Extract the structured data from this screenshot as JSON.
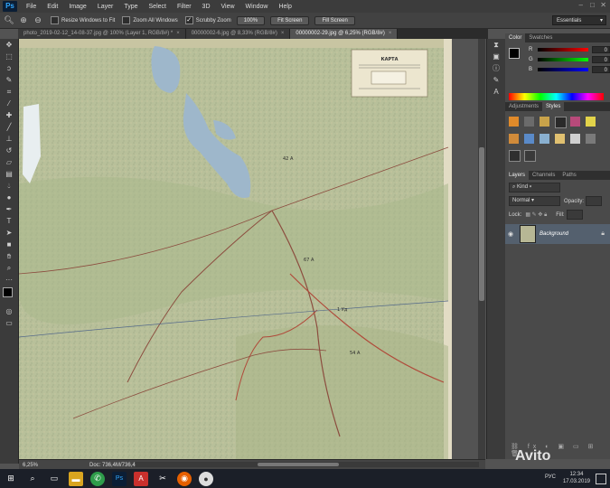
{
  "menubar": {
    "logo": "Ps",
    "items": [
      "File",
      "Edit",
      "Image",
      "Layer",
      "Type",
      "Select",
      "Filter",
      "3D",
      "View",
      "Window",
      "Help"
    ]
  },
  "options": {
    "resize_windows": "Resize Windows to Fit",
    "zoom_all": "Zoom All Windows",
    "scrubby_zoom": "Scrubby Zoom",
    "zoom_btn": "100%",
    "fit_screen": "Fit Screen",
    "fill_screen": "Fill Screen",
    "workspace": "Essentials"
  },
  "tabs": [
    {
      "label": "photo_2019-02-12_14-08-37.jpg @ 100% (Layer 1, RGB/8#) *"
    },
    {
      "label": "00000002-6.jpg @ 8,33% (RGB/8#)"
    },
    {
      "label": "00000002-29.jpg @ 6,25% (RGB/8#)"
    }
  ],
  "map": {
    "stamp_lines": [
      "КАРТА",
      "...",
      "..."
    ],
    "labels": [
      "42 А",
      "67 А",
      "1 Уд",
      "54 А"
    ]
  },
  "status": {
    "zoom": "6,25%",
    "doc": "Doc: 736,4M/736,4M"
  },
  "color_panel": {
    "tabs": [
      "Color",
      "Swatches"
    ],
    "r_label": "R",
    "g_label": "G",
    "b_label": "B",
    "r": "0",
    "g": "0",
    "b": "0"
  },
  "adjust_panel": {
    "tabs": [
      "Adjustments",
      "Styles"
    ]
  },
  "layers_panel": {
    "tabs": [
      "Layers",
      "Channels",
      "Paths"
    ],
    "kind": "Kind",
    "blend": "Normal",
    "opacity_label": "Opacity:",
    "lock_label": "Lock:",
    "fill_label": "Fill:",
    "layer_name": "Background"
  },
  "taskbar": {
    "lang": "РУС",
    "time": "12:34",
    "date": "17.03.2019"
  },
  "watermark": "Avito"
}
